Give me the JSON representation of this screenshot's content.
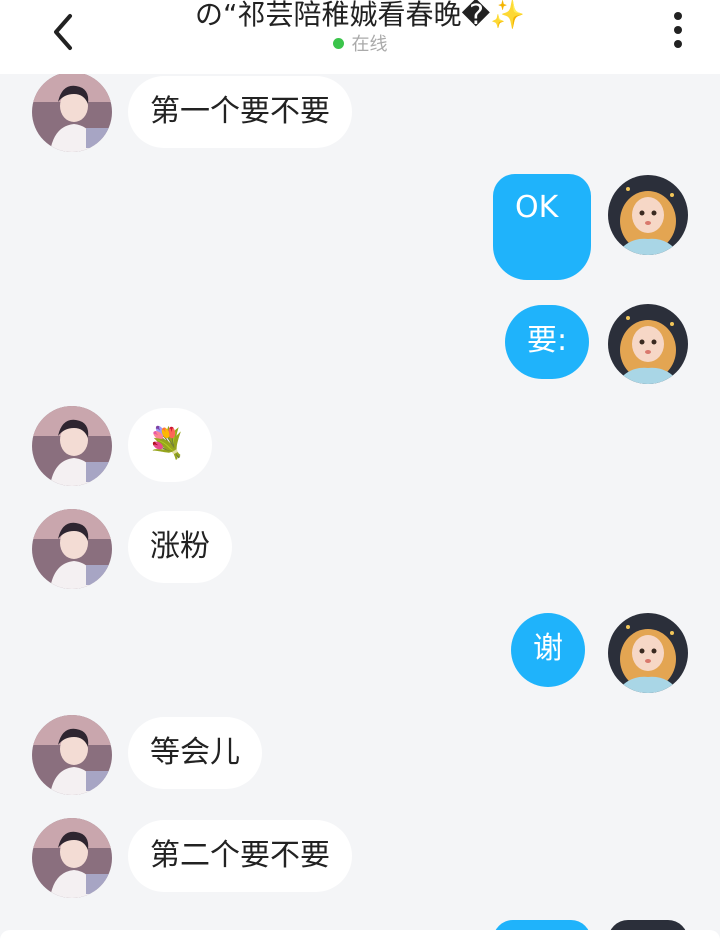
{
  "header": {
    "title": "の“祁芸陪稚娍看春晚�✨",
    "status": "在线",
    "status_color": "#3bc44b",
    "back_icon": "chevron-left-icon",
    "more_icon": "vertical-ellipsis-icon"
  },
  "colors": {
    "background": "#f4f5f7",
    "incoming_bubble": "#ffffff",
    "outgoing_bubble": "#1fb3fb"
  },
  "messages": [
    {
      "side": "left",
      "text": "第一个要不要"
    },
    {
      "side": "right",
      "text": "OK"
    },
    {
      "side": "right",
      "text": "要:"
    },
    {
      "side": "left",
      "text": "💐",
      "icon": "bouquet-emoji"
    },
    {
      "side": "left",
      "text": "涨粉"
    },
    {
      "side": "right",
      "text": "谢"
    },
    {
      "side": "left",
      "text": "等会儿"
    },
    {
      "side": "left",
      "text": "第二个要不要"
    }
  ]
}
